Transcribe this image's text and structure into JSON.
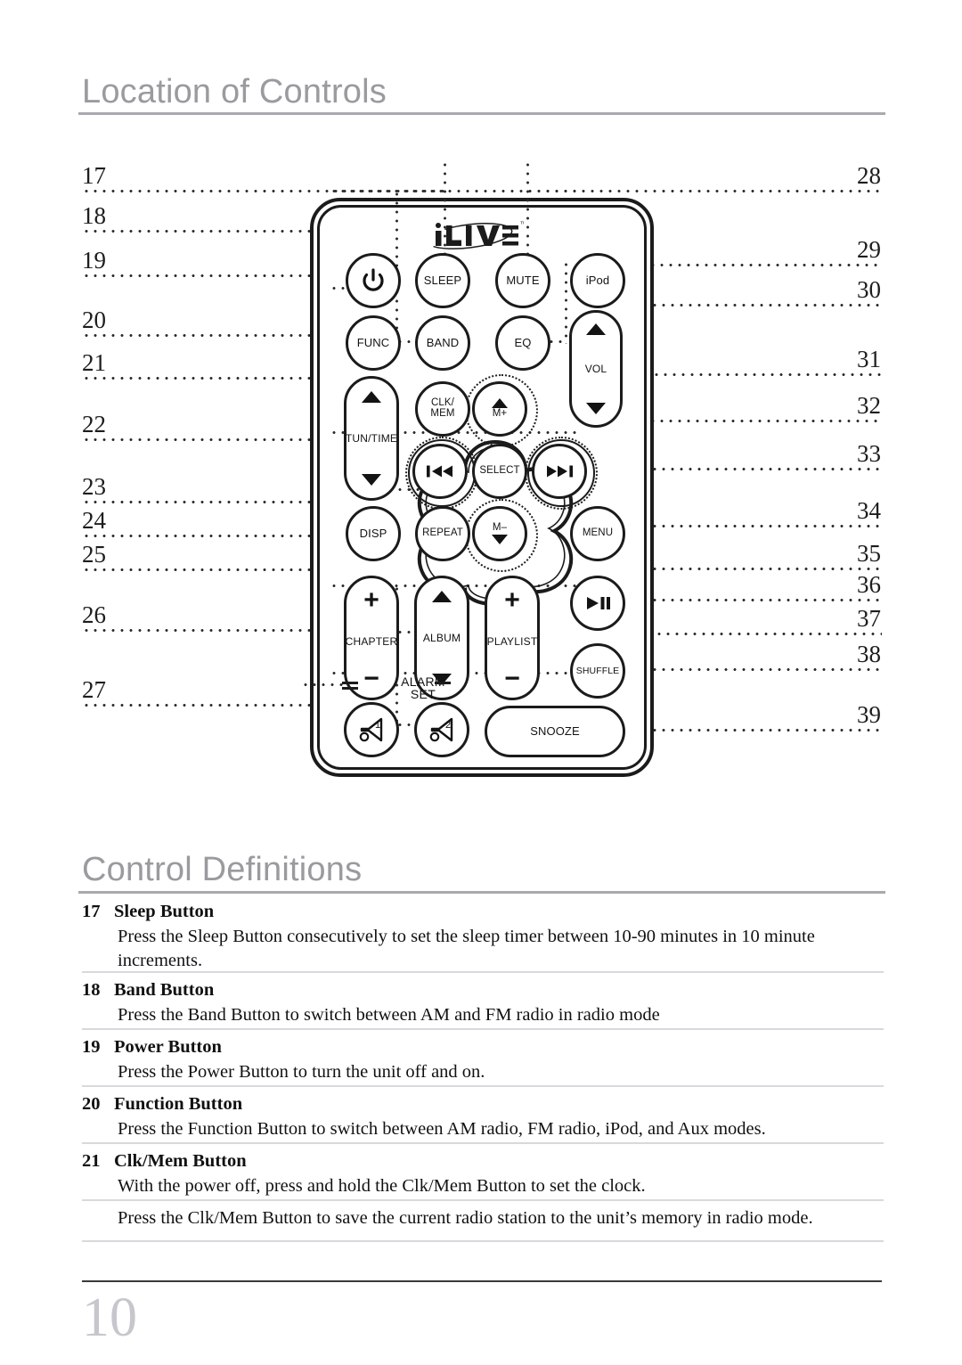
{
  "sections": {
    "location_heading": "Location of Controls",
    "definitions_heading": "Control Definitions"
  },
  "callouts": {
    "left": [
      "17",
      "18",
      "19",
      "20",
      "21",
      "22",
      "23",
      "24",
      "25",
      "26",
      "27"
    ],
    "right": [
      "28",
      "29",
      "30",
      "31",
      "32",
      "33",
      "34",
      "35",
      "36",
      "37",
      "38",
      "39"
    ]
  },
  "remote": {
    "brand": "iLIVE",
    "brand_tm": "™",
    "buttons": {
      "power": "power-symbol",
      "sleep": "SLEEP",
      "mute": "MUTE",
      "ipod": "iPod",
      "func": "FUNC",
      "band": "BAND",
      "eq": "EQ",
      "vol": "VOL",
      "tun_time": "TUN/TIME",
      "clk_mem_l1": "CLK/",
      "clk_mem_l2": "MEM",
      "m_plus": "M+",
      "prev": "▮◀◀",
      "select": "SELECT",
      "next": "▶▶▮",
      "disp": "DISP",
      "repeat": "REPEAT",
      "m_minus": "M–",
      "menu": "MENU",
      "chapter": "CHAPTER",
      "album": "ALBUM",
      "playlist": "PLAYLIST",
      "play_pause": "▶❙❙",
      "shuffle": "SHUFFLE",
      "alarm1": "1",
      "alarm2": "2",
      "alarm_label_l1": "ALARM",
      "alarm_label_l2": "SET",
      "snooze": "SNOOZE"
    }
  },
  "definitions": [
    {
      "num": "17",
      "title": "Sleep Button",
      "body": "Press the Sleep Button consecutively to set the sleep timer between 10-90 minutes in 10 minute increments."
    },
    {
      "num": "18",
      "title": "Band Button",
      "body": "Press the Band Button to switch between AM and FM radio in radio mode"
    },
    {
      "num": "19",
      "title": "Power Button",
      "body": "Press the Power Button to turn the unit off and on."
    },
    {
      "num": "20",
      "title": "Function Button",
      "body": "Press the Function Button to switch between AM radio, FM radio, iPod, and Aux modes."
    },
    {
      "num": "21",
      "title": "Clk/Mem Button",
      "body": "With the power off, press and hold the Clk/Mem Button to set the clock."
    },
    {
      "num": "",
      "title": "",
      "body": "Press the Clk/Mem Button to save the current radio station to the unit’s memory in radio mode."
    }
  ],
  "footer": {
    "page_number": "10"
  }
}
